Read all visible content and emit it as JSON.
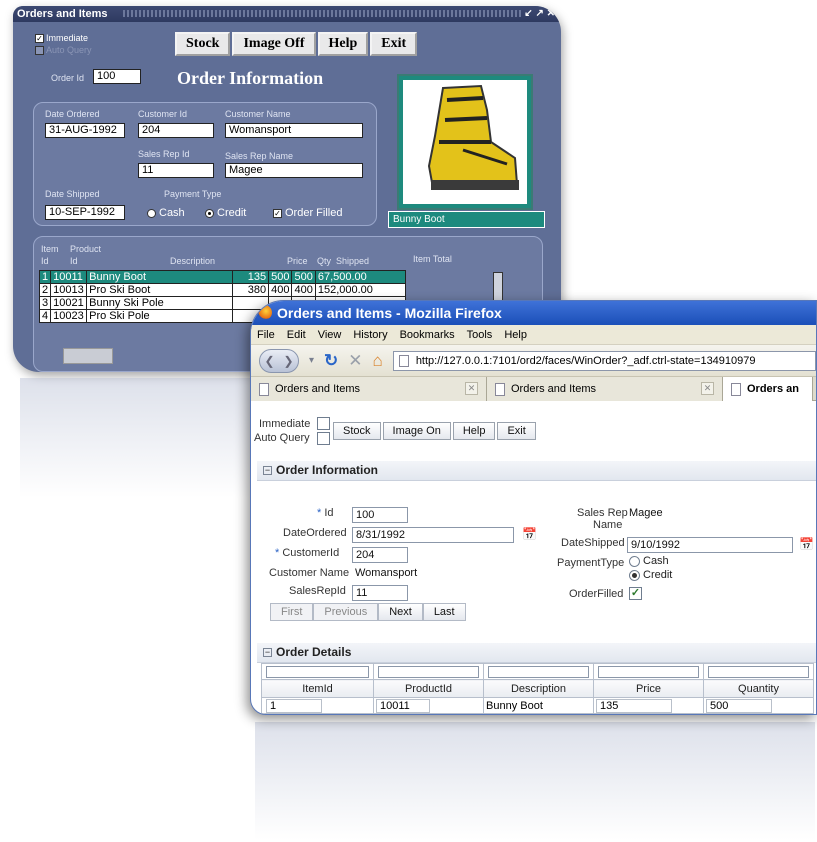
{
  "forms": {
    "title": "Orders and Items",
    "immediate_label": "Immediate",
    "auto_query_label": "Auto Query",
    "buttons": [
      "Stock",
      "Image Off",
      "Help",
      "Exit"
    ],
    "heading": "Order Information",
    "order_id_label": "Order Id",
    "order_id": "100",
    "date_ordered_label": "Date Ordered",
    "date_ordered": "31-AUG-1992",
    "customer_id_label": "Customer Id",
    "customer_id": "204",
    "customer_name_label": "Customer Name",
    "customer_name": "Womansport",
    "sales_rep_id_label": "Sales Rep Id",
    "sales_rep_id": "11",
    "sales_rep_name_label": "Sales Rep Name",
    "sales_rep_name": "Magee",
    "date_shipped_label": "Date Shipped",
    "date_shipped": "10-SEP-1992",
    "payment_type_label": "Payment Type",
    "payment_cash": "Cash",
    "payment_credit": "Credit",
    "order_filled": "Order Filled",
    "image_caption": "Bunny Boot",
    "items_headers": {
      "item": "Item",
      "id": "Id",
      "product": "Product",
      "product_id": "Id",
      "description": "Description",
      "price": "Price",
      "qty": "Qty",
      "shipped": "Shipped",
      "total": "Item Total"
    },
    "items": [
      {
        "item": "1",
        "product": "10011",
        "description": "Bunny Boot",
        "price": "135",
        "qty": "500",
        "shipped": "500",
        "total": "67,500.00"
      },
      {
        "item": "2",
        "product": "10013",
        "description": "Pro Ski Boot",
        "price": "380",
        "qty": "400",
        "shipped": "400",
        "total": "152,000.00"
      },
      {
        "item": "3",
        "product": "10021",
        "description": "Bunny Ski Pole",
        "price": "",
        "qty": "",
        "shipped": "",
        "total": ""
      },
      {
        "item": "4",
        "product": "10023",
        "description": "Pro Ski Pole",
        "price": "",
        "qty": "",
        "shipped": "",
        "total": ""
      }
    ]
  },
  "firefox": {
    "title": "Orders and Items - Mozilla Firefox",
    "menu": [
      "File",
      "Edit",
      "View",
      "History",
      "Bookmarks",
      "Tools",
      "Help"
    ],
    "url": "http://127.0.0.1:7101/ord2/faces/WinOrder?_adf.ctrl-state=134910979",
    "tabs": [
      "Orders and Items",
      "Orders and Items",
      "Orders an"
    ],
    "immediate_label": "Immediate",
    "auto_query_label": "Auto Query",
    "buttons": [
      "Stock",
      "Image On",
      "Help",
      "Exit"
    ],
    "order_info_header": "Order Information",
    "id_label": "Id",
    "id": "100",
    "date_ordered_label": "DateOrdered",
    "date_ordered": "8/31/1992",
    "customer_id_label": "CustomerId",
    "customer_id": "204",
    "customer_name_label": "Customer Name",
    "customer_name": "Womansport",
    "sales_rep_id_label": "SalesRepId",
    "sales_rep_id": "11",
    "sales_rep_name_label_1": "Sales Rep",
    "sales_rep_name_label_2": "Name",
    "sales_rep_name": "Magee",
    "date_shipped_label": "DateShipped",
    "date_shipped": "9/10/1992",
    "payment_type_label": "PaymentType",
    "payment_cash": "Cash",
    "payment_credit": "Credit",
    "order_filled_label": "OrderFilled",
    "pager": [
      "First",
      "Previous",
      "Next",
      "Last"
    ],
    "order_details_header": "Order Details",
    "table_headers": [
      "ItemId",
      "ProductId",
      "Description",
      "Price",
      "Quantity"
    ],
    "table_row": {
      "item_id": "1",
      "product_id": "10011",
      "description": "Bunny Boot",
      "price": "135",
      "quantity": "500"
    }
  }
}
